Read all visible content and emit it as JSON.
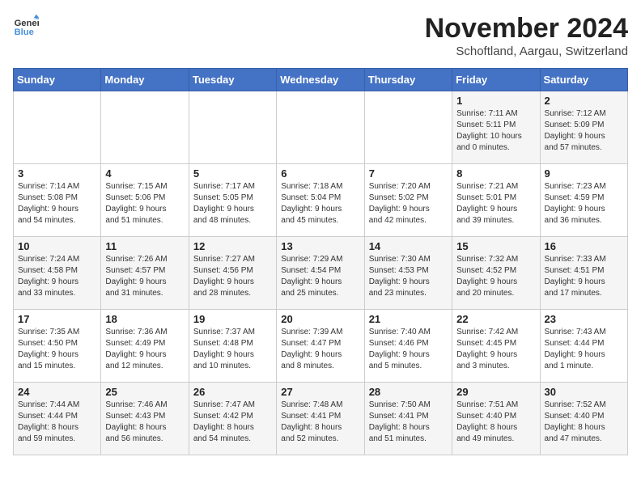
{
  "header": {
    "logo_general": "General",
    "logo_blue": "Blue",
    "month_title": "November 2024",
    "location": "Schoftland, Aargau, Switzerland"
  },
  "days_of_week": [
    "Sunday",
    "Monday",
    "Tuesday",
    "Wednesday",
    "Thursday",
    "Friday",
    "Saturday"
  ],
  "weeks": [
    [
      {
        "day": "",
        "info": ""
      },
      {
        "day": "",
        "info": ""
      },
      {
        "day": "",
        "info": ""
      },
      {
        "day": "",
        "info": ""
      },
      {
        "day": "",
        "info": ""
      },
      {
        "day": "1",
        "info": "Sunrise: 7:11 AM\nSunset: 5:11 PM\nDaylight: 10 hours\nand 0 minutes."
      },
      {
        "day": "2",
        "info": "Sunrise: 7:12 AM\nSunset: 5:09 PM\nDaylight: 9 hours\nand 57 minutes."
      }
    ],
    [
      {
        "day": "3",
        "info": "Sunrise: 7:14 AM\nSunset: 5:08 PM\nDaylight: 9 hours\nand 54 minutes."
      },
      {
        "day": "4",
        "info": "Sunrise: 7:15 AM\nSunset: 5:06 PM\nDaylight: 9 hours\nand 51 minutes."
      },
      {
        "day": "5",
        "info": "Sunrise: 7:17 AM\nSunset: 5:05 PM\nDaylight: 9 hours\nand 48 minutes."
      },
      {
        "day": "6",
        "info": "Sunrise: 7:18 AM\nSunset: 5:04 PM\nDaylight: 9 hours\nand 45 minutes."
      },
      {
        "day": "7",
        "info": "Sunrise: 7:20 AM\nSunset: 5:02 PM\nDaylight: 9 hours\nand 42 minutes."
      },
      {
        "day": "8",
        "info": "Sunrise: 7:21 AM\nSunset: 5:01 PM\nDaylight: 9 hours\nand 39 minutes."
      },
      {
        "day": "9",
        "info": "Sunrise: 7:23 AM\nSunset: 4:59 PM\nDaylight: 9 hours\nand 36 minutes."
      }
    ],
    [
      {
        "day": "10",
        "info": "Sunrise: 7:24 AM\nSunset: 4:58 PM\nDaylight: 9 hours\nand 33 minutes."
      },
      {
        "day": "11",
        "info": "Sunrise: 7:26 AM\nSunset: 4:57 PM\nDaylight: 9 hours\nand 31 minutes."
      },
      {
        "day": "12",
        "info": "Sunrise: 7:27 AM\nSunset: 4:56 PM\nDaylight: 9 hours\nand 28 minutes."
      },
      {
        "day": "13",
        "info": "Sunrise: 7:29 AM\nSunset: 4:54 PM\nDaylight: 9 hours\nand 25 minutes."
      },
      {
        "day": "14",
        "info": "Sunrise: 7:30 AM\nSunset: 4:53 PM\nDaylight: 9 hours\nand 23 minutes."
      },
      {
        "day": "15",
        "info": "Sunrise: 7:32 AM\nSunset: 4:52 PM\nDaylight: 9 hours\nand 20 minutes."
      },
      {
        "day": "16",
        "info": "Sunrise: 7:33 AM\nSunset: 4:51 PM\nDaylight: 9 hours\nand 17 minutes."
      }
    ],
    [
      {
        "day": "17",
        "info": "Sunrise: 7:35 AM\nSunset: 4:50 PM\nDaylight: 9 hours\nand 15 minutes."
      },
      {
        "day": "18",
        "info": "Sunrise: 7:36 AM\nSunset: 4:49 PM\nDaylight: 9 hours\nand 12 minutes."
      },
      {
        "day": "19",
        "info": "Sunrise: 7:37 AM\nSunset: 4:48 PM\nDaylight: 9 hours\nand 10 minutes."
      },
      {
        "day": "20",
        "info": "Sunrise: 7:39 AM\nSunset: 4:47 PM\nDaylight: 9 hours\nand 8 minutes."
      },
      {
        "day": "21",
        "info": "Sunrise: 7:40 AM\nSunset: 4:46 PM\nDaylight: 9 hours\nand 5 minutes."
      },
      {
        "day": "22",
        "info": "Sunrise: 7:42 AM\nSunset: 4:45 PM\nDaylight: 9 hours\nand 3 minutes."
      },
      {
        "day": "23",
        "info": "Sunrise: 7:43 AM\nSunset: 4:44 PM\nDaylight: 9 hours\nand 1 minute."
      }
    ],
    [
      {
        "day": "24",
        "info": "Sunrise: 7:44 AM\nSunset: 4:44 PM\nDaylight: 8 hours\nand 59 minutes."
      },
      {
        "day": "25",
        "info": "Sunrise: 7:46 AM\nSunset: 4:43 PM\nDaylight: 8 hours\nand 56 minutes."
      },
      {
        "day": "26",
        "info": "Sunrise: 7:47 AM\nSunset: 4:42 PM\nDaylight: 8 hours\nand 54 minutes."
      },
      {
        "day": "27",
        "info": "Sunrise: 7:48 AM\nSunset: 4:41 PM\nDaylight: 8 hours\nand 52 minutes."
      },
      {
        "day": "28",
        "info": "Sunrise: 7:50 AM\nSunset: 4:41 PM\nDaylight: 8 hours\nand 51 minutes."
      },
      {
        "day": "29",
        "info": "Sunrise: 7:51 AM\nSunset: 4:40 PM\nDaylight: 8 hours\nand 49 minutes."
      },
      {
        "day": "30",
        "info": "Sunrise: 7:52 AM\nSunset: 4:40 PM\nDaylight: 8 hours\nand 47 minutes."
      }
    ]
  ]
}
